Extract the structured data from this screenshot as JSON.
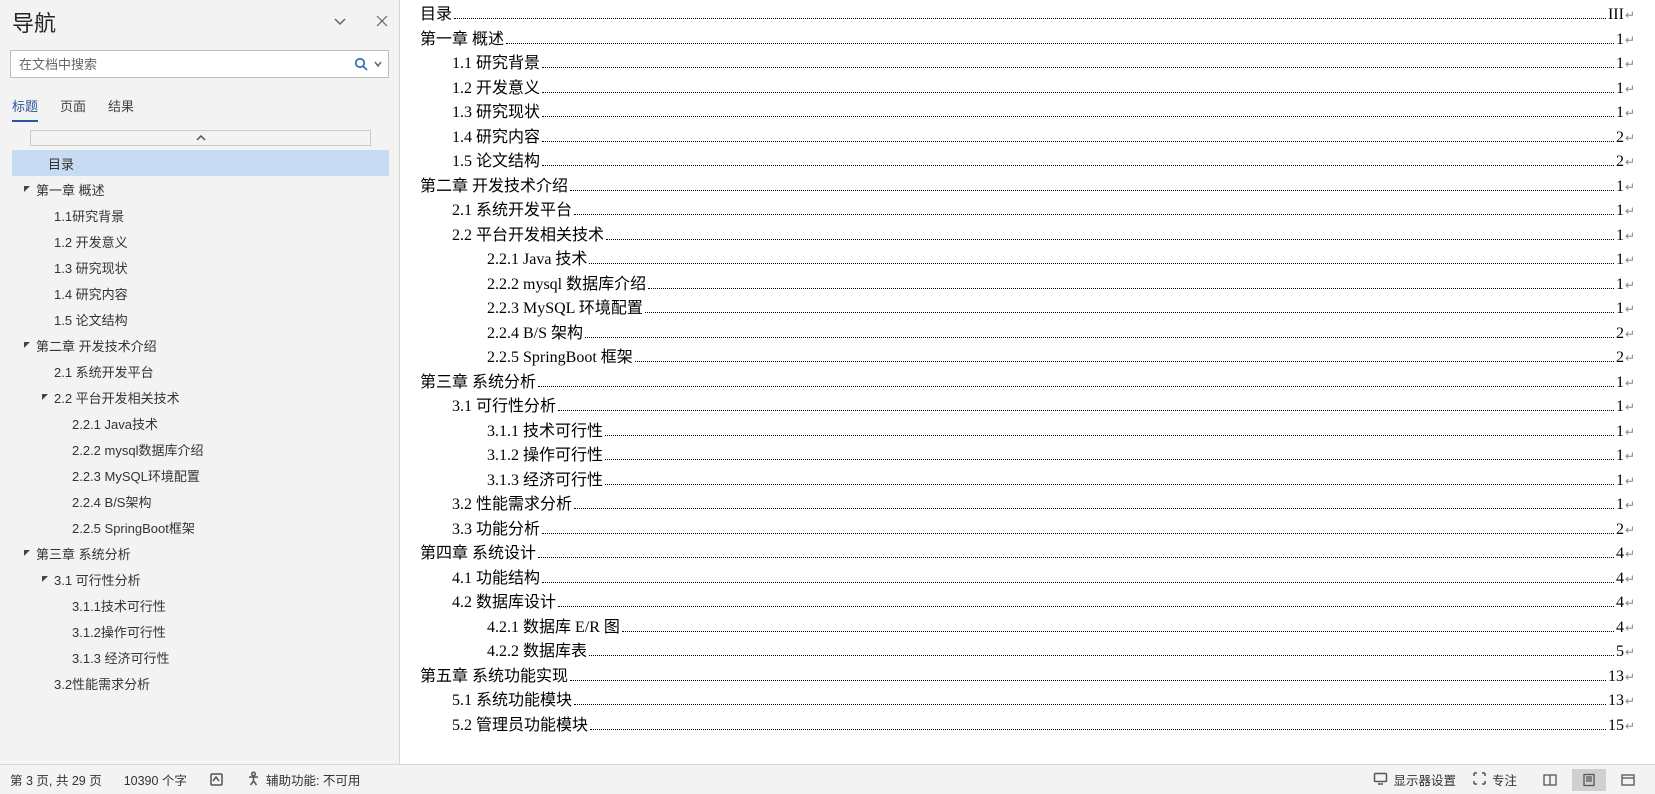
{
  "nav": {
    "title": "导航",
    "search_placeholder": "在文档中搜索",
    "tabs": {
      "headings": "标题",
      "pages": "页面",
      "results": "结果"
    },
    "tree": [
      {
        "label": "目录",
        "level": 0,
        "expander": false,
        "selected": true
      },
      {
        "label": "第一章 概述",
        "level": 0,
        "expander": true
      },
      {
        "label": "1.1研究背景",
        "level": 1,
        "expander": false
      },
      {
        "label": "1.2 开发意义",
        "level": 1,
        "expander": false
      },
      {
        "label": "1.3 研究现状",
        "level": 1,
        "expander": false
      },
      {
        "label": "1.4 研究内容",
        "level": 1,
        "expander": false
      },
      {
        "label": "1.5 论文结构",
        "level": 1,
        "expander": false
      },
      {
        "label": "第二章 开发技术介绍",
        "level": 0,
        "expander": true
      },
      {
        "label": "2.1 系统开发平台",
        "level": 1,
        "expander": false
      },
      {
        "label": "2.2 平台开发相关技术",
        "level": 1,
        "expander": true
      },
      {
        "label": "2.2.1 Java技术",
        "level": 2,
        "expander": false
      },
      {
        "label": "2.2.2 mysql数据库介绍",
        "level": 2,
        "expander": false
      },
      {
        "label": "2.2.3 MySQL环境配置",
        "level": 2,
        "expander": false
      },
      {
        "label": "2.2.4 B/S架构",
        "level": 2,
        "expander": false
      },
      {
        "label": "2.2.5 SpringBoot框架",
        "level": 2,
        "expander": false
      },
      {
        "label": "第三章 系统分析",
        "level": 0,
        "expander": true
      },
      {
        "label": "3.1 可行性分析",
        "level": 1,
        "expander": true
      },
      {
        "label": "3.1.1技术可行性",
        "level": 2,
        "expander": false
      },
      {
        "label": "3.1.2操作可行性",
        "level": 2,
        "expander": false
      },
      {
        "label": "3.1.3 经济可行性",
        "level": 2,
        "expander": false
      },
      {
        "label": "3.2性能需求分析",
        "level": 1,
        "expander": false
      }
    ]
  },
  "toc_lines": [
    {
      "text": "目录",
      "page": "III",
      "indent": 0
    },
    {
      "text": "第一章  概述",
      "page": "1",
      "indent": 0
    },
    {
      "text": "1.1 研究背景",
      "page": "1",
      "indent": 1
    },
    {
      "text": "1.2  开发意义",
      "page": "1",
      "indent": 1
    },
    {
      "text": "1.3  研究现状",
      "page": "1",
      "indent": 1
    },
    {
      "text": "1.4  研究内容",
      "page": "2",
      "indent": 1
    },
    {
      "text": "1.5  论文结构",
      "page": "2",
      "indent": 1
    },
    {
      "text": "第二章  开发技术介绍",
      "page": "1",
      "indent": 0
    },
    {
      "text": "2.1  系统开发平台",
      "page": "1",
      "indent": 1
    },
    {
      "text": "2.2  平台开发相关技术",
      "page": "1",
      "indent": 1
    },
    {
      "text": "2.2.1 Java 技术 ",
      "page": "1",
      "indent": 2
    },
    {
      "text": "2.2.2 mysql 数据库介绍",
      "page": "1",
      "indent": 2
    },
    {
      "text": "2.2.3 MySQL 环境配置",
      "page": "1",
      "indent": 2
    },
    {
      "text": "2.2.4 B/S 架构",
      "page": "2",
      "indent": 2
    },
    {
      "text": "2.2.5 SpringBoot 框架",
      "page": "2",
      "indent": 2
    },
    {
      "text": "第三章  系统分析",
      "page": "1",
      "indent": 0
    },
    {
      "text": "3.1  可行性分析",
      "page": "1",
      "indent": 1
    },
    {
      "text": "3.1.1  技术可行性",
      "page": "1",
      "indent": 2
    },
    {
      "text": "3.1.2  操作可行性",
      "page": "1",
      "indent": 2
    },
    {
      "text": "3.1.3  经济可行性",
      "page": "1",
      "indent": 2
    },
    {
      "text": "3.2 性能需求分析",
      "page": "1",
      "indent": 1
    },
    {
      "text": "3.3 功能分析",
      "page": "2",
      "indent": 1
    },
    {
      "text": "第四章  系统设计",
      "page": "4",
      "indent": 0
    },
    {
      "text": "4.1 功能结构",
      "page": "4",
      "indent": 1
    },
    {
      "text": "4.2  数据库设计",
      "page": "4",
      "indent": 1
    },
    {
      "text": "4.2.1  数据库 E/R 图 ",
      "page": "4",
      "indent": 2
    },
    {
      "text": "4.2.2  数据库表",
      "page": "5",
      "indent": 2
    },
    {
      "text": "第五章  系统功能实现",
      "page": "13",
      "indent": 0
    },
    {
      "text": "5.1 系统功能模块",
      "page": "13",
      "indent": 1
    },
    {
      "text": "5.2 管理员功能模块",
      "page": "15",
      "indent": 1
    }
  ],
  "status": {
    "page_info": "第 3 页, 共 29 页",
    "word_count": "10390 个字",
    "accessibility": "辅助功能: 不可用",
    "display_settings": "显示器设置",
    "focus": "专注"
  }
}
